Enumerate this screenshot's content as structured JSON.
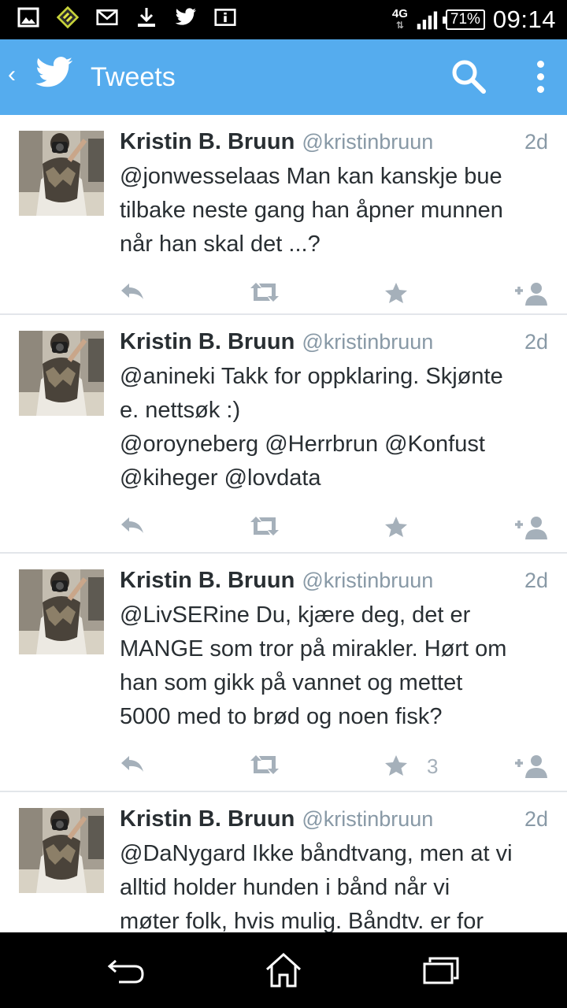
{
  "status_bar": {
    "network": "4G",
    "battery": "71%",
    "time": "09:14"
  },
  "app_bar": {
    "back_glyph": "‹",
    "title": "Tweets"
  },
  "tweets": [
    {
      "name": "Kristin B. Bruun",
      "handle": "@kristinbruun",
      "time": "2d",
      "text": "@jonwesselaas Man kan kanskje bue\ntilbake neste gang han åpner munnen\nnår han skal det ...?",
      "favorites": ""
    },
    {
      "name": "Kristin B. Bruun",
      "handle": "@kristinbruun",
      "time": "2d",
      "text": "@anineki Takk for oppklaring. Skjønte\ne. nettsøk :)\n@oroyneberg @Herrbrun @Konfust\n@kiheger @lovdata",
      "favorites": ""
    },
    {
      "name": "Kristin B. Bruun",
      "handle": "@kristinbruun",
      "time": "2d",
      "text": "@LivSERine Du, kjære deg, det er\nMANGE som tror på mirakler. Hørt om\nhan som gikk på vannet og mettet\n5000 med to brød og noen fisk?",
      "favorites": "3"
    },
    {
      "name": "Kristin B. Bruun",
      "handle": "@kristinbruun",
      "time": "2d",
      "text": "@DaNygard Ikke båndtvang, men at vi\nalltid holder hunden i bånd når vi\nmøter folk, hvis mulig. Båndtv. er for",
      "favorites": ""
    }
  ],
  "icons": {
    "status_left": [
      "image-icon",
      "game-icon",
      "gmail-icon",
      "download-icon",
      "twitter-icon",
      "info-icon"
    ],
    "actions": [
      "reply-icon",
      "retweet-icon",
      "star-icon",
      "follow-icon"
    ],
    "nav": [
      "back-icon",
      "home-icon",
      "recent-apps-icon"
    ]
  },
  "colors": {
    "brand": "#55acee",
    "text": "#292f33",
    "secondary": "#8899a6",
    "action_icon": "#a5b0ba"
  }
}
